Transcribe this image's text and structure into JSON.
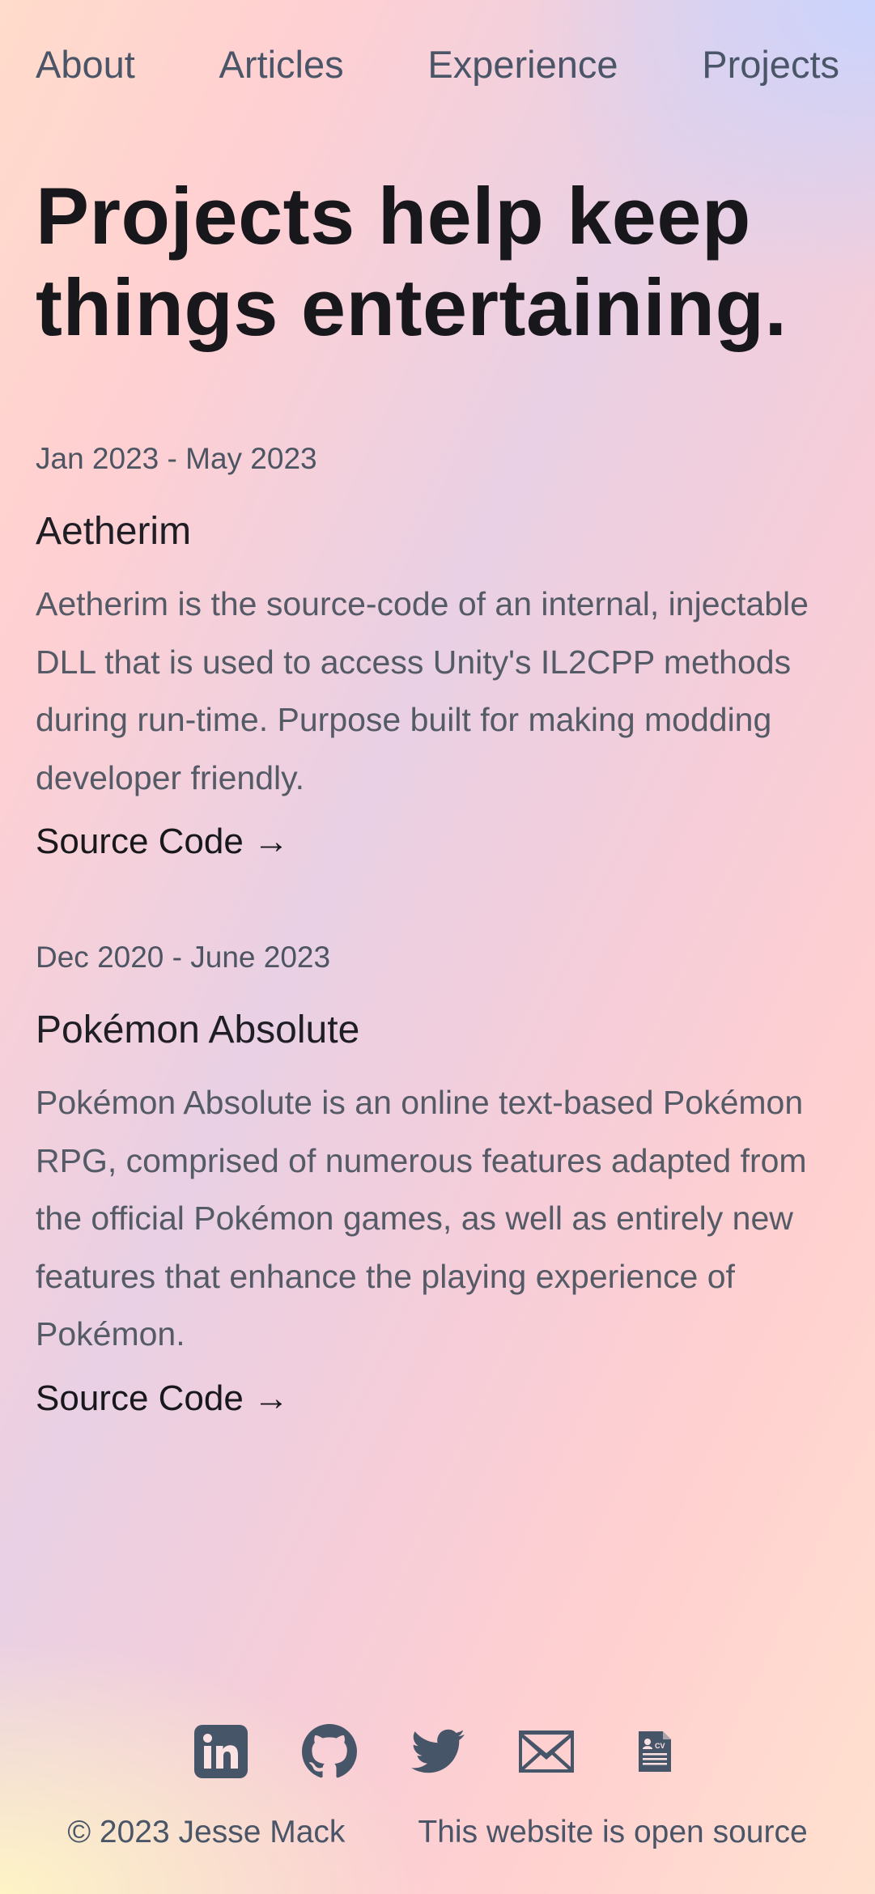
{
  "nav": {
    "items": [
      {
        "label": "About"
      },
      {
        "label": "Articles"
      },
      {
        "label": "Experience"
      },
      {
        "label": "Projects"
      }
    ]
  },
  "headline": "Projects help keep things entertaining.",
  "projects": [
    {
      "date": "Jan 2023 - May 2023",
      "title": "Aetherim",
      "description": "Aetherim is the source-code of an internal, injectable DLL that is used to access Unity's IL2CPP methods during run-time. Purpose built for making modding developer friendly.",
      "link_label": "Source Code →"
    },
    {
      "date": "Dec 2020 - June 2023",
      "title": "Pokémon Absolute",
      "description": "Pokémon Absolute is an online text-based Pokémon RPG, comprised of numerous features adapted from the official Pokémon games, as well as entirely new features that enhance the playing experience of Pokémon.",
      "link_label": "Source Code →"
    }
  ],
  "socials": {
    "icons": [
      "linkedin-icon",
      "github-icon",
      "twitter-icon",
      "email-icon",
      "cv-icon"
    ],
    "icon_color": "#475569"
  },
  "footer": {
    "copyright": "© 2023 Jesse Mack",
    "open_source": "This website is open source"
  },
  "colors": {
    "text_dark": "#18181c",
    "text_muted": "#4a5568",
    "bg_peach": "#ffdccb",
    "bg_pink": "#ffd0d2",
    "bg_lavender": "#c8d4ff",
    "bg_yellow": "#fff6c4"
  }
}
